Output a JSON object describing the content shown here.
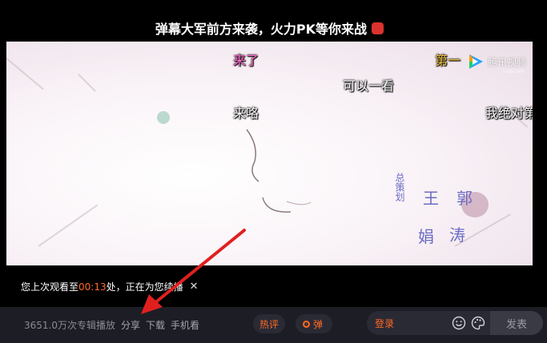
{
  "banner": {
    "text": "弹幕大军前方来袭，火力PK等你来战"
  },
  "danmaku": [
    {
      "text": "来了",
      "color": "#ff66cc"
    },
    {
      "text": "第一",
      "color": "#f0c23a"
    },
    {
      "text": "可以一看",
      "color": "#ffffff"
    },
    {
      "text": "来咯",
      "color": "#ffffff"
    },
    {
      "text": "我绝对第",
      "color": "#ffffff"
    }
  ],
  "logo": {
    "text": "腾讯视频",
    "sub": "v.qq.com"
  },
  "credits": {
    "role": "总策划",
    "names": [
      "王",
      "郭",
      "娟",
      "涛"
    ]
  },
  "resume": {
    "prefix": "您上次观看至",
    "time": "00:13",
    "suffix": "处，正在为您续播",
    "close": "✕"
  },
  "toolbar": {
    "stats": "3651.0万次专辑播放",
    "share": "分享",
    "download": "下载",
    "mobile": "手机看",
    "hot_comments": "热评",
    "danmu_toggle": "弹",
    "login": "登录",
    "send": "发表",
    "icons": [
      "smile-icon",
      "palette-icon"
    ]
  },
  "colors": {
    "accent": "#ff6a24",
    "bar_bg": "#1d1d25",
    "annotation_arrow": "#e02020"
  }
}
